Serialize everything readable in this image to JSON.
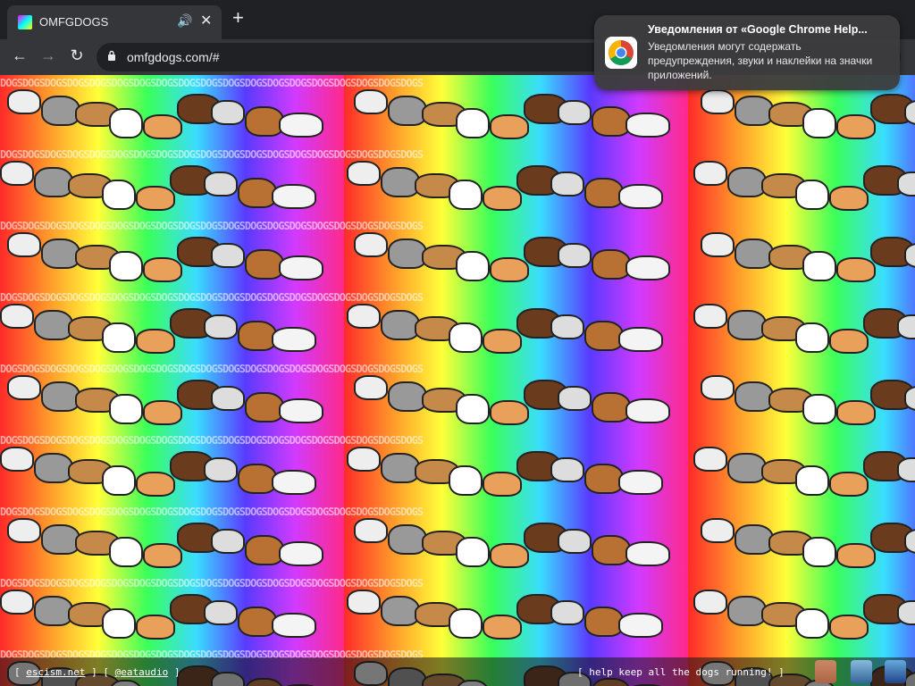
{
  "tab": {
    "title": "OMFGDOGS"
  },
  "address": {
    "url": "omfgdogs.com/#"
  },
  "page": {
    "tile_text": "DOGSDOGSDOGSDOGSDOGSDOGSDOGSDOGSDOGSDOGSDOGSDOGSDOGSDOGSDOGSDOGSDOGSDOGSDOGS"
  },
  "footer": {
    "left_open": "[ ",
    "link1": "escism.net",
    "mid": " ] [ ",
    "link2": "@eataudio",
    "left_close": " ]",
    "right": "[ help keep all the dogs running! ]"
  },
  "notification": {
    "title": "Уведомления от «Google Chrome Help...",
    "body": "Уведомления могут содержать предупреждения, звуки и наклейки на значки приложений."
  },
  "colors": {
    "chrome_dark": "#202124",
    "chrome_mid": "#35363a"
  }
}
